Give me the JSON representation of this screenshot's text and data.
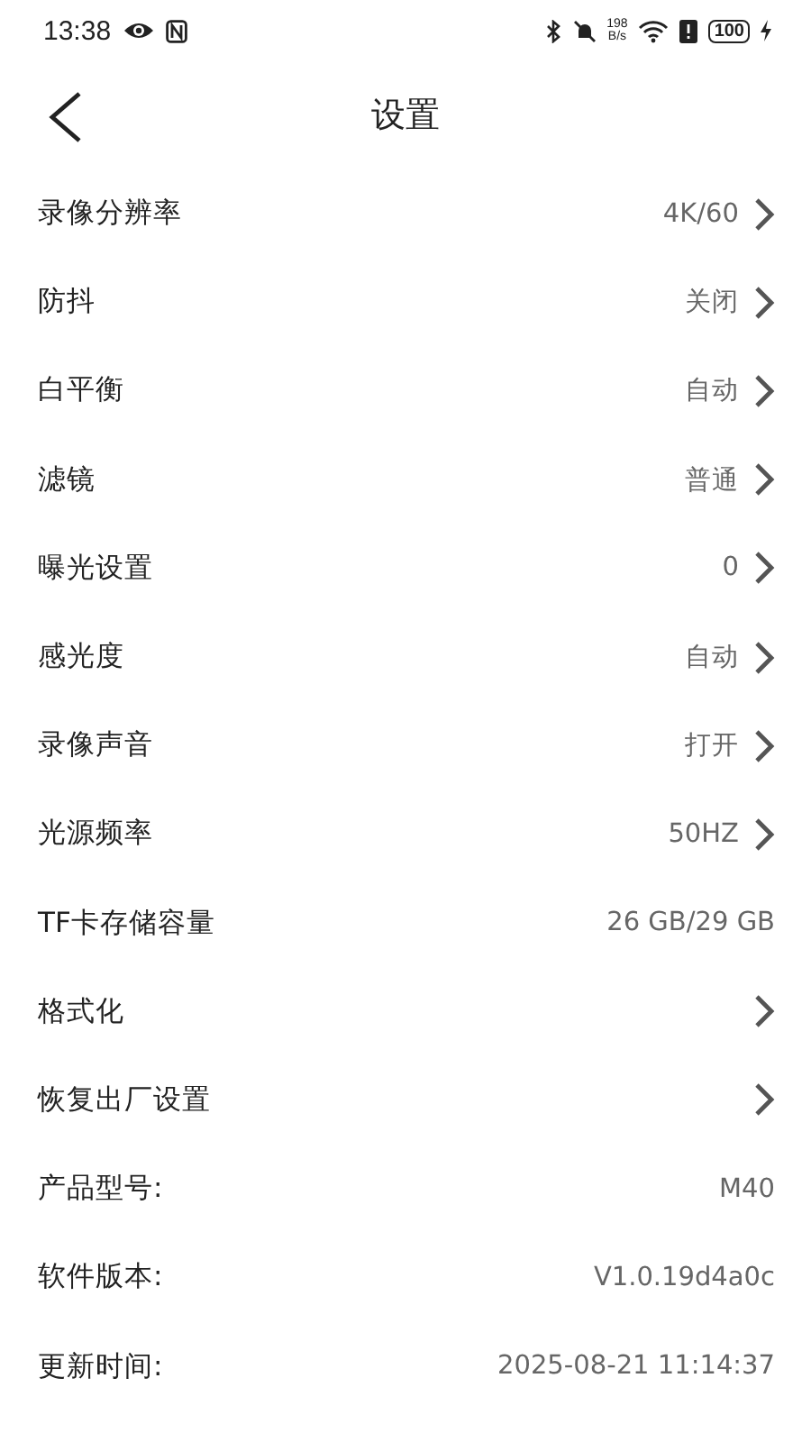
{
  "status_bar": {
    "time": "13:38",
    "net_speed": "198\nB/s",
    "battery": "100"
  },
  "header": {
    "title": "设置"
  },
  "rows": [
    {
      "label": "录像分辨率",
      "value": "4K/60",
      "kind": "nav"
    },
    {
      "label": "防抖",
      "value": "关闭",
      "kind": "nav"
    },
    {
      "label": "白平衡",
      "value": "自动",
      "kind": "nav"
    },
    {
      "label": "滤镜",
      "value": "普通",
      "kind": "nav"
    },
    {
      "label": "曝光设置",
      "value": "0",
      "kind": "nav"
    },
    {
      "label": "感光度",
      "value": "自动",
      "kind": "nav"
    },
    {
      "label": "录像声音",
      "value": "打开",
      "kind": "nav"
    },
    {
      "label": "光源频率",
      "value": "50HZ",
      "kind": "nav"
    },
    {
      "label": "TF卡存储容量",
      "value": "26 GB/29 GB",
      "kind": "info"
    },
    {
      "label": "格式化",
      "kind": "nav"
    },
    {
      "label": "恢复出厂设置",
      "kind": "nav"
    },
    {
      "label": "产品型号:",
      "value": "M40",
      "kind": "info"
    },
    {
      "label": "软件版本:",
      "value": "V1.0.19d4a0c",
      "kind": "info"
    },
    {
      "label": "更新时间:",
      "value": "2025-08-21 11:14:37",
      "kind": "info"
    }
  ]
}
